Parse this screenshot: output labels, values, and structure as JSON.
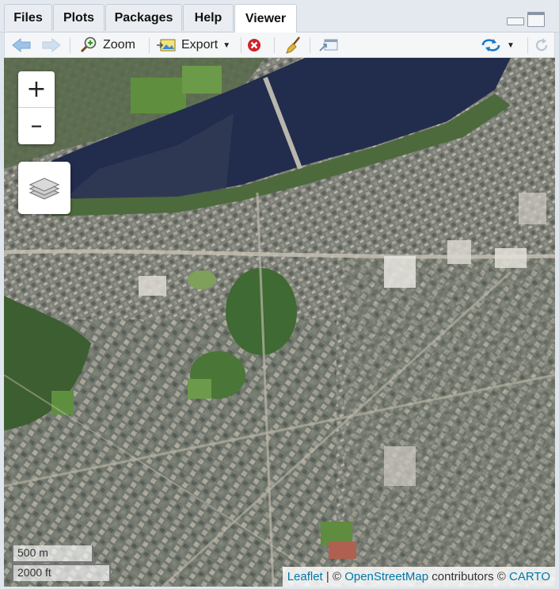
{
  "tabs": [
    {
      "label": "Files",
      "active": false
    },
    {
      "label": "Plots",
      "active": false
    },
    {
      "label": "Packages",
      "active": false
    },
    {
      "label": "Help",
      "active": false
    },
    {
      "label": "Viewer",
      "active": true
    }
  ],
  "toolbar": {
    "zoom_label": "Zoom",
    "export_label": "Export"
  },
  "map": {
    "zoom_in_label": "+",
    "zoom_out_label": "–",
    "scale_metric": "500 m",
    "scale_imperial": "2000 ft",
    "attribution": {
      "leaflet": "Leaflet",
      "separator": " | © ",
      "osm": "OpenStreetMap",
      "contributors": " contributors © ",
      "carto": "CARTO"
    },
    "colors": {
      "water": "#1f2a4a",
      "link": "#0078a8"
    }
  }
}
